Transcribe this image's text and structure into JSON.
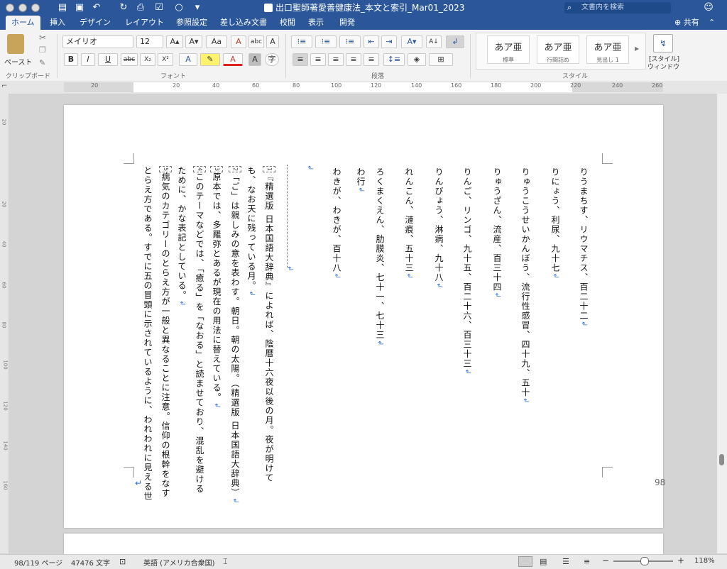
{
  "window": {
    "title": "出口聖師著愛善健康法_本文と索引_Mar01_2023",
    "search_placeholder": "文書内を検索",
    "share_label": "共有"
  },
  "tabs": [
    "ホーム",
    "挿入",
    "デザイン",
    "レイアウト",
    "参照設定",
    "差し込み文書",
    "校閲",
    "表示",
    "開発"
  ],
  "ribbon": {
    "clipboard": {
      "paste_label": "ペースト",
      "group_label": "クリップボード"
    },
    "font": {
      "font_name": "メイリオ",
      "font_size": "12",
      "group_label": "フォント",
      "bold": "B",
      "italic": "I",
      "underline": "U",
      "strike": "abc",
      "sub": "X₂",
      "sup": "X²"
    },
    "paragraph": {
      "group_label": "段落"
    },
    "styles": {
      "group_label": "スタイル",
      "items": [
        {
          "sample": "あア亜",
          "name": "標準"
        },
        {
          "sample": "あア亜",
          "name": "行間詰め"
        },
        {
          "sample": "あア亜",
          "name": "見出し 1"
        }
      ],
      "pane_label_1": "[スタイル]",
      "pane_label_2": "ウィンドウ"
    }
  },
  "ruler": {
    "h_numbers": [
      "20",
      "20",
      "40",
      "60",
      "80",
      "100",
      "120",
      "140",
      "160",
      "180",
      "200",
      "220",
      "240",
      "260"
    ],
    "v_numbers": [
      "20",
      "20",
      "40",
      "60",
      "80",
      "100",
      "120",
      "140",
      "160"
    ]
  },
  "document": {
    "columns": [
      "りうまちす、リウマチス、百二十二",
      "りにょう、利尿、九十七",
      "りゅうこうせいかんぼう、流行性感冒、四十九、五十",
      "りゅうざん、流産、百三十四",
      "りんご、リンゴ、九十五、百二十六、百三十三",
      "りんびょう、淋病、九十八",
      "れんこん、漣痕、五十三",
      "ろくまくえん、肋膜炎、七十一、七十三",
      "わ行",
      "わきが、わきが、百十八"
    ],
    "footnotes": [
      {
        "mark": "1",
        "text": "『精選版 日本国語大辞典』によれば、陰暦十六夜以後の月。夜が明けて",
        "cont": "も、なお天に残っている月。"
      },
      {
        "mark": "2",
        "text": "「ご」は親しみの意を表わす。朝日。朝の太陽。（精選版 日本国語大辞典）"
      },
      {
        "mark": "3",
        "text": "原本では、多羅弥とあるが現在の用法に替えている。"
      },
      {
        "mark": "4",
        "text": "このテーマなどでは、「癒る」を「なおる」と読ませており、混乱を避ける",
        "cont": "ために、かな表記としている。"
      },
      {
        "mark": "5",
        "text": "病気のカテゴリーのとらえ方が一般と異なることに注意。信仰の根幹をなす",
        "cont": "とらえ方である。すでに五の冒頭に示されているように、われわれに見える世"
      }
    ],
    "page_number": "98"
  },
  "status": {
    "page": "98/119 ページ",
    "words": "47476 文字",
    "language": "英語 (アメリカ合衆国)",
    "zoom": "118%"
  }
}
